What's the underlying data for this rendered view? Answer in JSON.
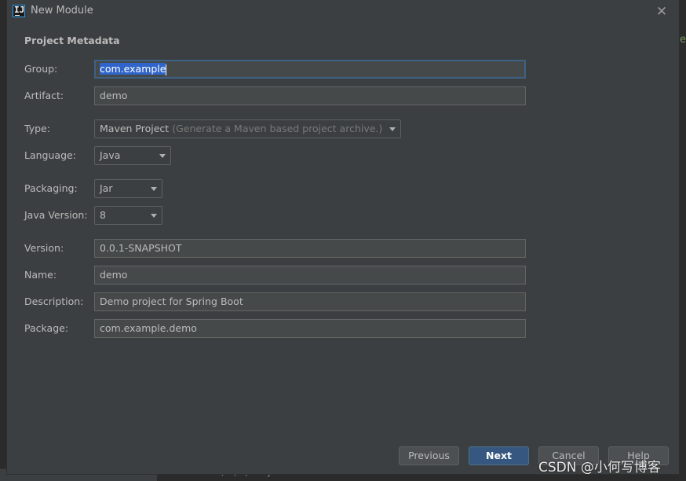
{
  "window": {
    "title": "New Module",
    "app_icon_glyph": "IJ",
    "close_glyph": "✕"
  },
  "section_title": "Project Metadata",
  "fields": {
    "group": {
      "label": "Group:",
      "value": "com.example"
    },
    "artifact": {
      "label": "Artifact:",
      "value": "demo"
    },
    "type": {
      "label": "Type:",
      "value": "Maven Project",
      "hint": "(Generate a Maven based project archive.)"
    },
    "language": {
      "label": "Language:",
      "value": "Java"
    },
    "packaging": {
      "label": "Packaging:",
      "value": "Jar"
    },
    "java_version": {
      "label": "Java Version:",
      "value": "8"
    },
    "version": {
      "label": "Version:",
      "value": "0.0.1-SNAPSHOT"
    },
    "name": {
      "label": "Name:",
      "value": "demo"
    },
    "description": {
      "label": "Description:",
      "value": "Demo project for Spring Boot"
    },
    "package": {
      "label": "Package:",
      "value": "com.example.demo"
    }
  },
  "buttons": {
    "previous": "Previous",
    "next": "Next",
    "cancel": "Cancel",
    "help": "Help"
  },
  "watermark": "CSDN @小何写博客",
  "background_code": {
    "right_gutter_char": "e",
    "bottom_fragment": "/ , ) r        y"
  },
  "colors": {
    "dialog_bg": "#3c3f41",
    "field_bg": "#45494a",
    "focus_border": "#3d6185",
    "selection": "#2f65ca",
    "primary_button": "#365880"
  }
}
